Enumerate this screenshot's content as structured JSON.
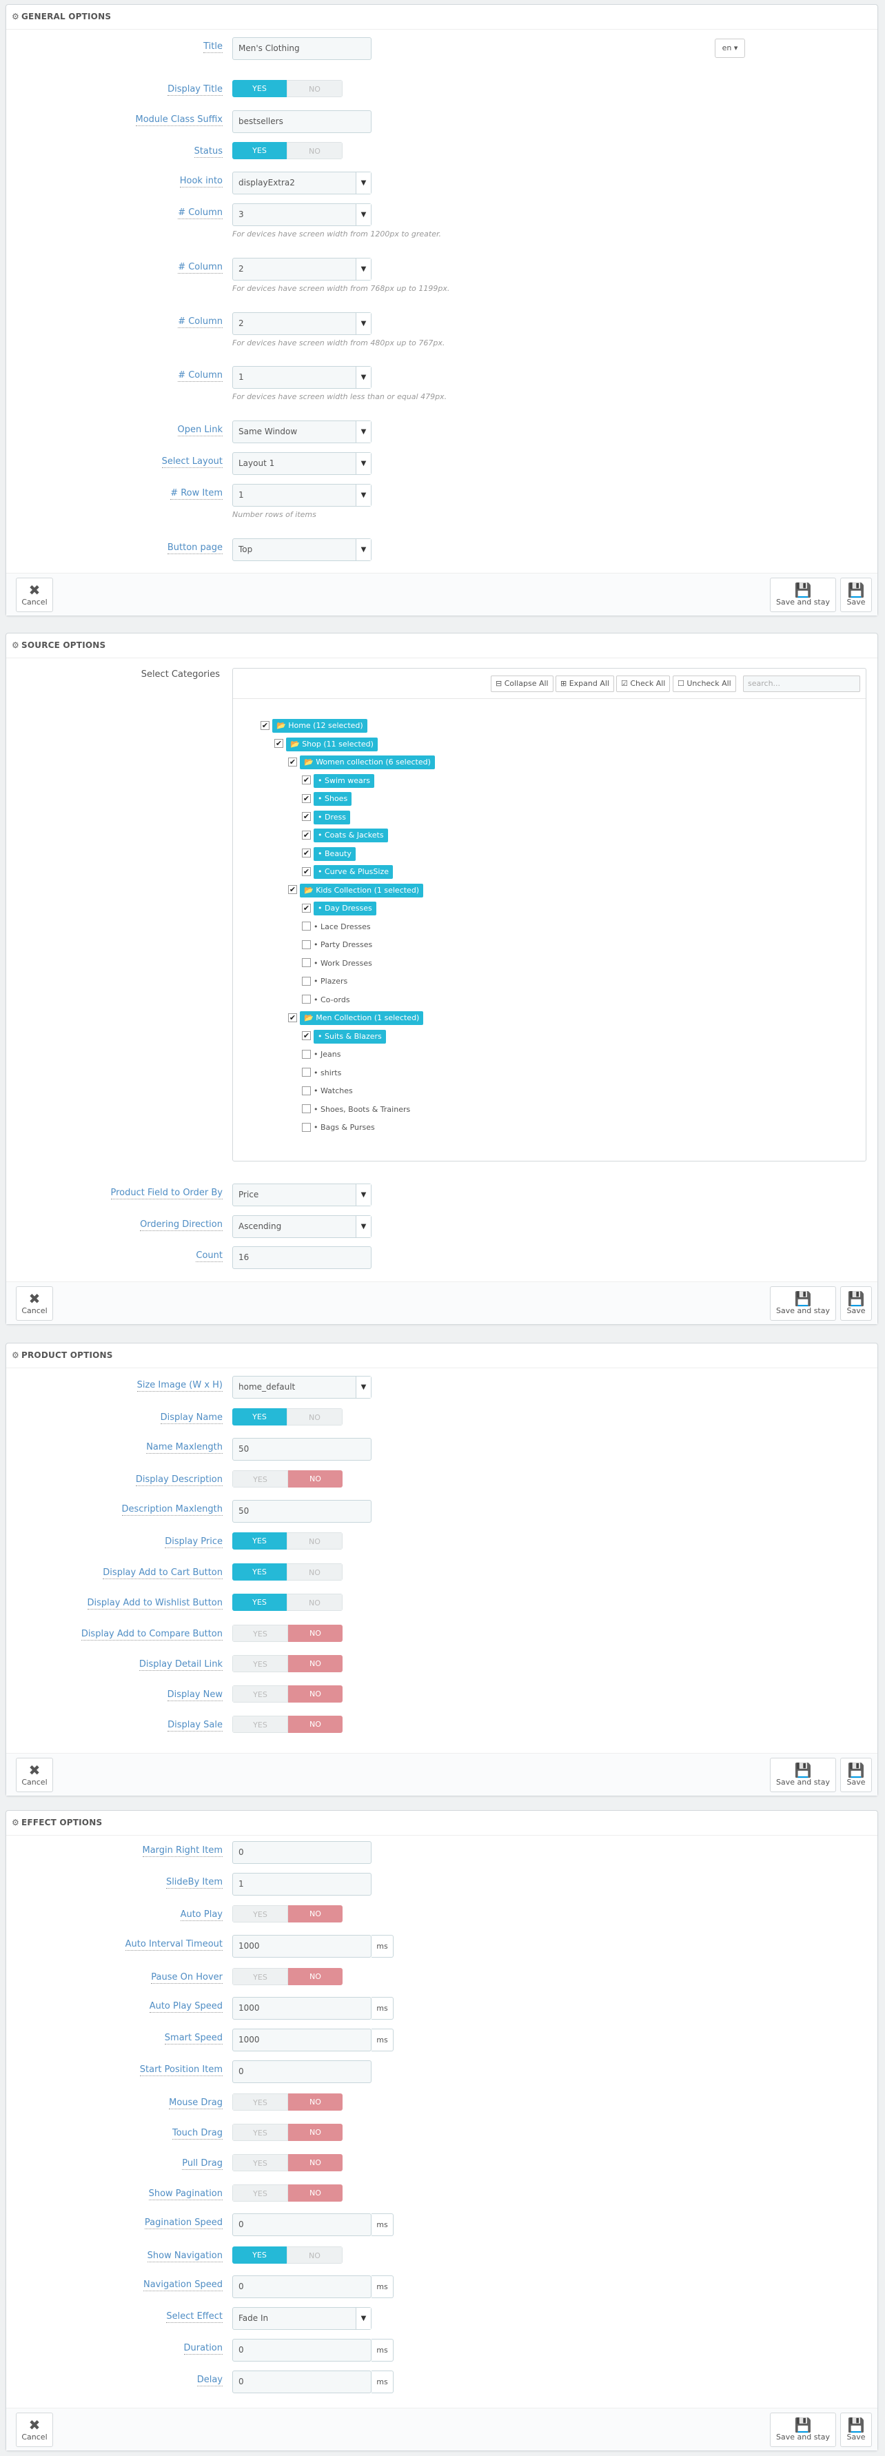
{
  "general": {
    "heading": "GENERAL OPTIONS",
    "title_label": "Title",
    "title_value": "Men's Clothing",
    "lang": "en",
    "display_title_label": "Display Title",
    "suffix_label": "Module Class Suffix",
    "suffix_value": "bestsellers",
    "status_label": "Status",
    "hook_label": "Hook into",
    "hook_value": "displayExtra2",
    "column_label": "# Column",
    "col1_value": "3",
    "col1_help": "For devices have screen width from 1200px to greater.",
    "col2_value": "2",
    "col2_help": "For devices have screen width from 768px up to 1199px.",
    "col3_value": "2",
    "col3_help": "For devices have screen width from 480px up to 767px.",
    "col4_value": "1",
    "col4_help": "For devices have screen width less than or equal 479px.",
    "open_link_label": "Open Link",
    "open_link_value": "Same Window",
    "layout_label": "Select Layout",
    "layout_value": "Layout 1",
    "row_item_label": "# Row Item",
    "row_item_value": "1",
    "row_item_help": "Number rows of items",
    "button_page_label": "Button page",
    "button_page_value": "Top"
  },
  "toggle": {
    "yes": "YES",
    "no": "NO"
  },
  "footer": {
    "cancel": "Cancel",
    "save_stay": "Save and stay",
    "save": "Save"
  },
  "source": {
    "heading": "SOURCE OPTIONS",
    "categories_label": "Select Categories",
    "collapse_all": "Collapse All",
    "expand_all": "Expand All",
    "check_all": "Check All",
    "uncheck_all": "Uncheck All",
    "search_placeholder": "search...",
    "tree": [
      {
        "label": "Home (12 selected)",
        "folder": true,
        "checked": true,
        "hl": true
      },
      {
        "label": "Shop (11 selected)",
        "folder": true,
        "checked": true,
        "hl": true
      },
      {
        "label": "Women collection (6 selected)",
        "folder": true,
        "checked": true,
        "hl": true
      },
      {
        "label": "Swim wears",
        "checked": true,
        "hl": true
      },
      {
        "label": "Shoes",
        "checked": true,
        "hl": true
      },
      {
        "label": "Dress",
        "checked": true,
        "hl": true
      },
      {
        "label": "Coats & Jackets",
        "checked": true,
        "hl": true
      },
      {
        "label": "Beauty",
        "checked": true,
        "hl": true
      },
      {
        "label": "Curve & PlusSize",
        "checked": true,
        "hl": true
      },
      {
        "label": "Kids Collection (1 selected)",
        "folder": true,
        "checked": true,
        "hl": true
      },
      {
        "label": "Day Dresses",
        "checked": true,
        "hl": true
      },
      {
        "label": "Lace Dresses",
        "checked": false,
        "hl": false
      },
      {
        "label": "Party Dresses",
        "checked": false,
        "hl": false
      },
      {
        "label": "Work Dresses",
        "checked": false,
        "hl": false
      },
      {
        "label": "Plazers",
        "checked": false,
        "hl": false
      },
      {
        "label": "Co-ords",
        "checked": false,
        "hl": false
      },
      {
        "label": "Men Collection (1 selected)",
        "folder": true,
        "checked": true,
        "hl": true
      },
      {
        "label": "Suits & Blazers",
        "checked": true,
        "hl": true
      },
      {
        "label": "Jeans",
        "checked": false,
        "hl": false
      },
      {
        "label": "shirts",
        "checked": false,
        "hl": false
      },
      {
        "label": "Watches",
        "checked": false,
        "hl": false
      },
      {
        "label": "Shoes, Boots & Trainers",
        "checked": false,
        "hl": false
      },
      {
        "label": "Bags & Purses",
        "checked": false,
        "hl": false
      }
    ],
    "order_by_label": "Product Field to Order By",
    "order_by_value": "Price",
    "direction_label": "Ordering Direction",
    "direction_value": "Ascending",
    "count_label": "Count",
    "count_value": "16"
  },
  "product": {
    "heading": "PRODUCT OPTIONS",
    "size_label": "Size Image (W x H)",
    "size_value": "home_default",
    "display_name_label": "Display Name",
    "name_max_label": "Name Maxlength",
    "name_max_value": "50",
    "display_desc_label": "Display Description",
    "desc_max_label": "Description Maxlength",
    "desc_max_value": "50",
    "display_price_label": "Display Price",
    "add_cart_label": "Display Add to Cart Button",
    "add_wish_label": "Display Add to Wishlist Button",
    "add_compare_label": "Display Add to Compare Button",
    "detail_link_label": "Display Detail Link",
    "display_new_label": "Display New",
    "display_sale_label": "Display Sale"
  },
  "effect": {
    "heading": "EFFECT OPTIONS",
    "unit": "ms",
    "margin_label": "Margin Right Item",
    "margin_value": "0",
    "slideby_label": "SlideBy Item",
    "slideby_value": "1",
    "autoplay_label": "Auto Play",
    "interval_label": "Auto Interval Timeout",
    "interval_value": "1000",
    "pause_label": "Pause On Hover",
    "autoplay_speed_label": "Auto Play Speed",
    "autoplay_speed_value": "1000",
    "smart_label": "Smart Speed",
    "smart_value": "1000",
    "start_label": "Start Position Item",
    "start_value": "0",
    "mouse_label": "Mouse Drag",
    "touch_label": "Touch Drag",
    "pull_label": "Pull Drag",
    "show_pag_label": "Show Pagination",
    "pag_speed_label": "Pagination Speed",
    "pag_speed_value": "0",
    "show_nav_label": "Show Navigation",
    "nav_speed_label": "Navigation Speed",
    "nav_speed_value": "0",
    "select_effect_label": "Select Effect",
    "select_effect_value": "Fade In",
    "duration_label": "Duration",
    "duration_value": "0",
    "delay_label": "Delay",
    "delay_value": "0"
  }
}
